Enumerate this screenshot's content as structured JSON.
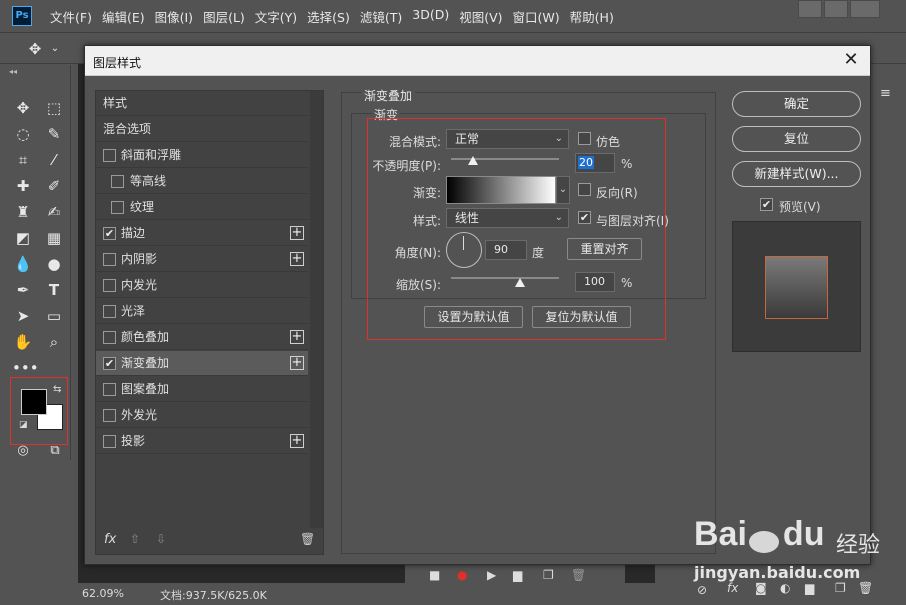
{
  "menubar": {
    "logo": "Ps",
    "items": [
      "文件(F)",
      "编辑(E)",
      "图像(I)",
      "图层(L)",
      "文字(Y)",
      "选择(S)",
      "滤镜(T)",
      "3D(D)",
      "视图(V)",
      "窗口(W)",
      "帮助(H)"
    ]
  },
  "status": {
    "zoom": "62.09%",
    "doc": "文档:937.5K/625.0K"
  },
  "dialog": {
    "title": "图层样式",
    "style_list": [
      {
        "label": "样式",
        "checkbox": false,
        "checked": false,
        "plus": false,
        "selected": false
      },
      {
        "label": "混合选项",
        "checkbox": false,
        "checked": false,
        "plus": false,
        "selected": false
      },
      {
        "label": "斜面和浮雕",
        "checkbox": true,
        "checked": false,
        "plus": false,
        "selected": false
      },
      {
        "label": "等高线",
        "checkbox": true,
        "checked": false,
        "plus": false,
        "selected": false,
        "indent": true
      },
      {
        "label": "纹理",
        "checkbox": true,
        "checked": false,
        "plus": false,
        "selected": false,
        "indent": true
      },
      {
        "label": "描边",
        "checkbox": true,
        "checked": true,
        "plus": true,
        "selected": false
      },
      {
        "label": "内阴影",
        "checkbox": true,
        "checked": false,
        "plus": true,
        "selected": false
      },
      {
        "label": "内发光",
        "checkbox": true,
        "checked": false,
        "plus": false,
        "selected": false
      },
      {
        "label": "光泽",
        "checkbox": true,
        "checked": false,
        "plus": false,
        "selected": false
      },
      {
        "label": "颜色叠加",
        "checkbox": true,
        "checked": false,
        "plus": true,
        "selected": false
      },
      {
        "label": "渐变叠加",
        "checkbox": true,
        "checked": true,
        "plus": true,
        "selected": true
      },
      {
        "label": "图案叠加",
        "checkbox": true,
        "checked": false,
        "plus": false,
        "selected": false
      },
      {
        "label": "外发光",
        "checkbox": true,
        "checked": false,
        "plus": false,
        "selected": false
      },
      {
        "label": "投影",
        "checkbox": true,
        "checked": false,
        "plus": true,
        "selected": false
      }
    ],
    "list_footer": {
      "fx": "fx"
    },
    "panel": {
      "group_title": "渐变叠加",
      "sub_title": "渐变",
      "blend_mode_label": "混合模式:",
      "blend_mode_value": "正常",
      "dither_label": "仿色",
      "opacity_label": "不透明度(P):",
      "opacity_value": "20",
      "opacity_unit": "%",
      "opacity_fraction": 0.2,
      "gradient_label": "渐变:",
      "reverse_label": "反向(R)",
      "style_label": "样式:",
      "style_value": "线性",
      "align_label": "与图层对齐(I)",
      "angle_label": "角度(N):",
      "angle_value": "90",
      "angle_unit": "度",
      "reset_align_button": "重置对齐",
      "scale_label": "缩放(S):",
      "scale_value": "100",
      "scale_unit": "%",
      "scale_fraction": 0.5,
      "set_default_button": "设置为默认值",
      "reset_default_button": "复位为默认值"
    },
    "buttons": {
      "ok": "确定",
      "reset": "复位",
      "new_style": "新建样式(W)...",
      "preview_label": "预览(V)"
    }
  },
  "watermark": {
    "brand": "Bai",
    "brand2": "du",
    "tag": "经验",
    "url": "jingyan.baidu.com"
  },
  "colors": {
    "highlight": "#e0302a",
    "foreground_swatch": "#000000",
    "background_swatch": "#ffffff"
  }
}
